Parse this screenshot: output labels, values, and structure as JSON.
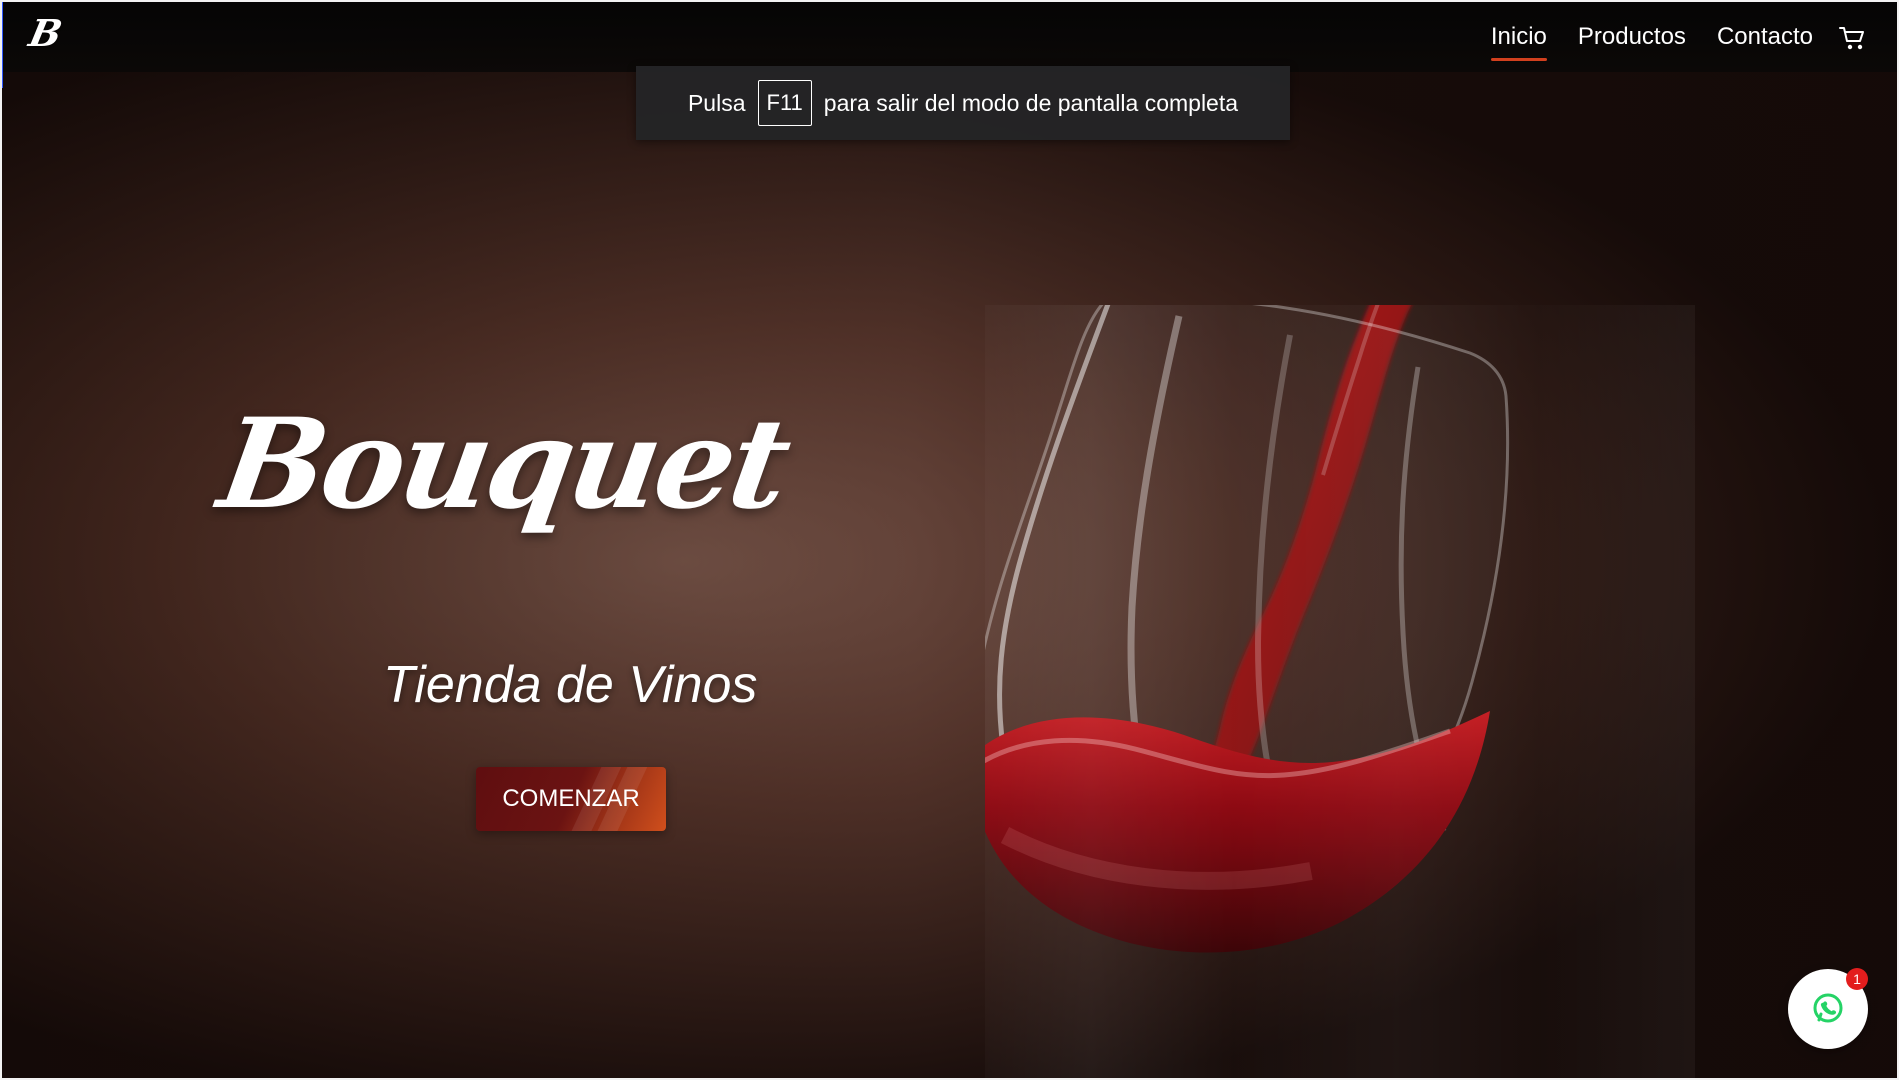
{
  "header": {
    "brand": "B",
    "nav": [
      {
        "label": "Inicio",
        "active": true
      },
      {
        "label": "Productos",
        "active": false
      },
      {
        "label": "Contacto",
        "active": false
      }
    ]
  },
  "overlay": {
    "prefix": "Pulsa",
    "key": "F11",
    "suffix": "para salir del modo de pantalla completa"
  },
  "hero": {
    "title": "Bouquet",
    "subtitle": "Tienda de Vinos",
    "button_label": "COMENZAR"
  },
  "chat": {
    "badge": "1"
  },
  "icons": {
    "cart": "cart-icon",
    "chat": "whatsapp-icon"
  },
  "colors": {
    "accent": "#d2401e",
    "button_dark": "#6b1312",
    "button_light": "#d04f1c",
    "badge": "#e31d1d",
    "chat_icon": "#25d366"
  }
}
